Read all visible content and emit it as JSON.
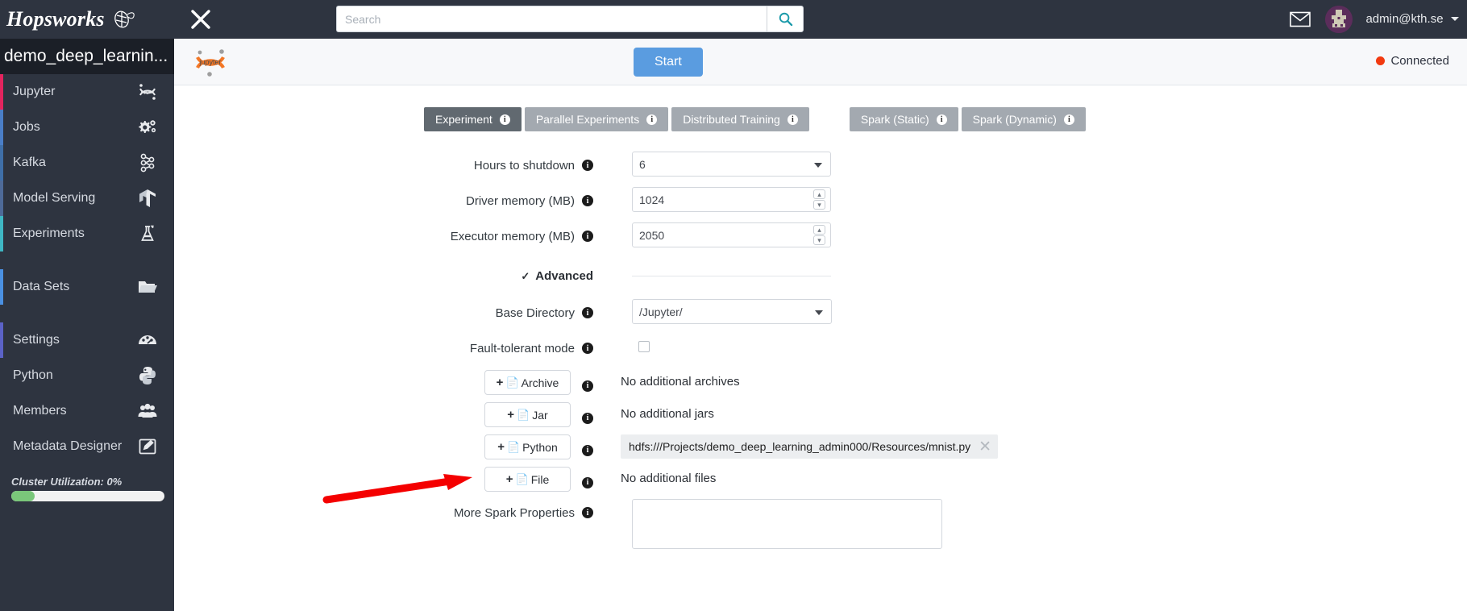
{
  "navbar": {
    "brand": "Hopsworks",
    "brand_logo_icon": "hops-logo-icon",
    "close_icon": "close-icon",
    "search": {
      "placeholder": "Search",
      "value": "",
      "button_icon": "search-icon"
    },
    "mail_icon": "mail-icon",
    "avatar_icon": "user-avatar",
    "user": "admin@kth.se",
    "caret_icon": "chevron-down-icon"
  },
  "sidebar": {
    "project": "demo_deep_learnin...",
    "items": [
      {
        "label": "Jupyter",
        "icon": "jupyter-icon",
        "accent": "#e3245e"
      },
      {
        "label": "Jobs",
        "icon": "gears-icon",
        "accent": "#4a7ec7"
      },
      {
        "label": "Kafka",
        "icon": "kafka-icon",
        "accent": "#3f6fa8"
      },
      {
        "label": "Model Serving",
        "icon": "tensorflow-icon",
        "accent": "#4e6a98"
      },
      {
        "label": "Experiments",
        "icon": "flask-icon",
        "accent": "#3fb7c4"
      },
      {
        "label": "Data Sets",
        "icon": "folder-icon",
        "accent": "#4a90e2"
      },
      {
        "label": "Settings",
        "icon": "dashboard-icon",
        "accent": "#5b62c6"
      },
      {
        "label": "Python",
        "icon": "python-icon",
        "accent": "#2e3440"
      },
      {
        "label": "Members",
        "icon": "people-icon",
        "accent": "#2e3440"
      },
      {
        "label": "Metadata Designer",
        "icon": "edit-square-icon",
        "accent": "#2e3440"
      }
    ],
    "cluster": {
      "label": "Cluster Utilization: 0%",
      "percent": 0,
      "bar_color": "#7ac77a"
    }
  },
  "content_header": {
    "logo_icon": "jupyter-logo-icon",
    "start_button": "Start",
    "status": "Connected",
    "status_color": "#f23a10"
  },
  "tabs": [
    {
      "label": "Experiment",
      "active": true,
      "info_icon": "info-icon"
    },
    {
      "label": "Parallel Experiments",
      "active": false,
      "info_icon": "info-icon"
    },
    {
      "label": "Distributed Training",
      "active": false,
      "info_icon": "info-icon"
    },
    {
      "label": "Spark (Static)",
      "active": false,
      "info_icon": "info-icon"
    },
    {
      "label": "Spark (Dynamic)",
      "active": false,
      "info_icon": "info-icon"
    }
  ],
  "form": {
    "hours_to_shutdown": {
      "label": "Hours to shutdown",
      "value": "6"
    },
    "driver_memory": {
      "label": "Driver memory (MB)",
      "value": "1024"
    },
    "executor_memory": {
      "label": "Executor memory (MB)",
      "value": "2050"
    },
    "advanced": {
      "label": "Advanced",
      "chevron": "⌄"
    },
    "base_directory": {
      "label": "Base Directory",
      "value": "/Jupyter/"
    },
    "fault_tolerant": {
      "label": "Fault-tolerant mode",
      "checked": false
    },
    "archive": {
      "label": "Archive",
      "plus": "+",
      "page_icon": "📄",
      "value": "No additional archives"
    },
    "jar": {
      "label": "Jar",
      "plus": "+",
      "page_icon": "📄",
      "value": "No additional jars"
    },
    "python": {
      "label": "Python",
      "plus": "+",
      "page_icon": "📄",
      "chip": "hdfs:///Projects/demo_deep_learning_admin000/Resources/mnist.py",
      "chip_close_icon": "close-icon"
    },
    "file": {
      "label": "File",
      "plus": "+",
      "page_icon": "📄",
      "value": "No additional files"
    },
    "more_spark_properties": {
      "label": "More Spark Properties",
      "value": "",
      "placeholder": ""
    }
  },
  "annotation": {
    "arrow_color": "#f40000",
    "points_to": "python-add-button"
  }
}
